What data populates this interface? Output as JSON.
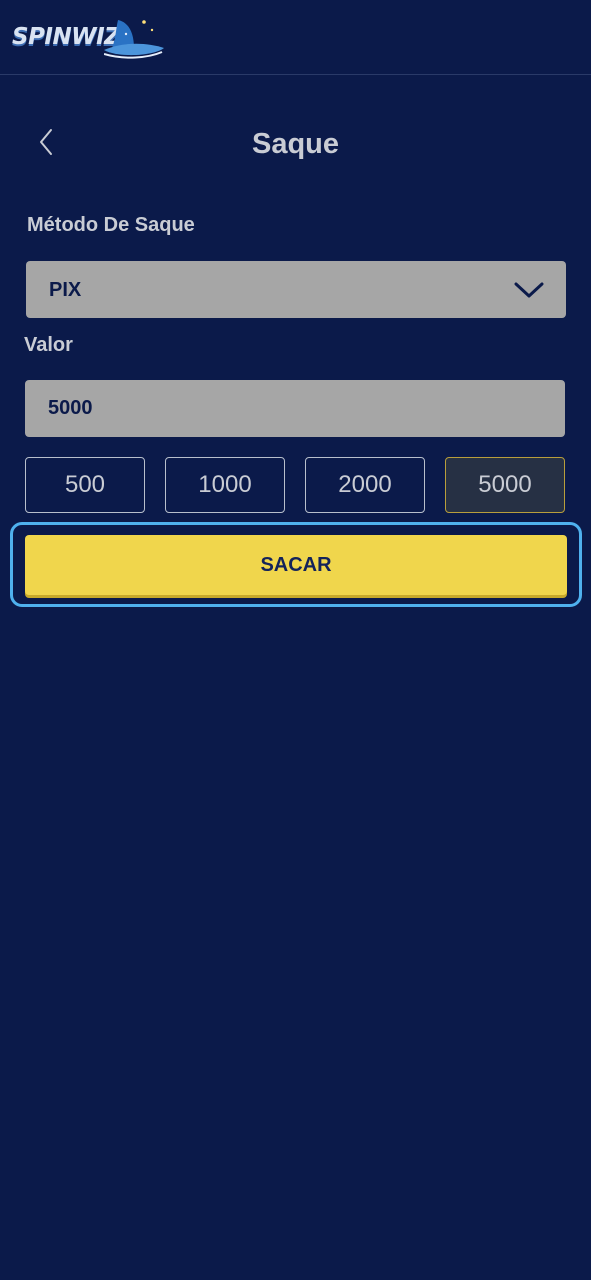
{
  "header": {
    "logo_text": "SPINWIZ"
  },
  "page": {
    "title": "Saque"
  },
  "form": {
    "method_label": "Método De Saque",
    "method_value": "PIX",
    "value_label": "Valor",
    "value_input": "5000",
    "amount_options": [
      "500",
      "1000",
      "2000",
      "5000"
    ],
    "selected_amount": "5000",
    "submit_label": "SACAR"
  },
  "colors": {
    "background": "#0b1a4a",
    "field_bg": "#a6a6a6",
    "accent_yellow": "#f0d64c",
    "focus_ring": "#4fb1ee"
  },
  "icons": {
    "back": "chevron-left-icon",
    "select": "chevron-down-icon",
    "logo": "wizard-hat-icon"
  }
}
